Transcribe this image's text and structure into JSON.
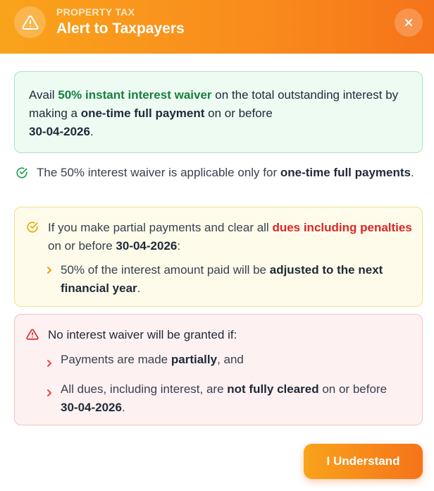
{
  "header": {
    "subtitle": "PROPERTY TAX",
    "title": "Alert to Taxpayers",
    "icon": "warning-triangle-icon",
    "close_icon": "close-icon"
  },
  "offer_box": {
    "text_1": "Avail ",
    "highlight": "50% instant interest waiver",
    "text_2": " on the total outstanding interest by making a ",
    "strong": "one-time full payment",
    "text_3": " on or before ",
    "date": "30-04-2026",
    "text_4": "."
  },
  "note": {
    "icon": "check-circle-icon",
    "text_1": "The 50% interest waiver is applicable only for ",
    "strong": "one-time full payments",
    "text_2": "."
  },
  "partial_box": {
    "icon": "check-circle-icon",
    "text_1": "If you make partial payments and clear all ",
    "highlight": "dues including penalties",
    "text_2": " on or before ",
    "date": "30-04-2026",
    "text_3": ":",
    "sub": {
      "icon": "chevron-right-icon",
      "text_1": "50% of the interest amount paid will be ",
      "strong": "adjusted to the next financial year",
      "text_2": "."
    }
  },
  "no_waiver_box": {
    "icon": "warning-triangle-icon",
    "heading": "No interest waiver will be granted if:",
    "items": [
      {
        "text_1": "Payments are made ",
        "strong": "partially",
        "text_2": ", and"
      },
      {
        "text_1": "All dues, including interest, are ",
        "strong": "not fully cleared",
        "text_2": " on or before ",
        "date": "30-04-2026",
        "text_3": "."
      }
    ]
  },
  "footer": {
    "button_label": "I Understand"
  },
  "colors": {
    "accent_orange": "#f98b1c",
    "success_green": "#17803d",
    "danger_red": "#dc2626",
    "warning_yellow": "#e6a700"
  }
}
